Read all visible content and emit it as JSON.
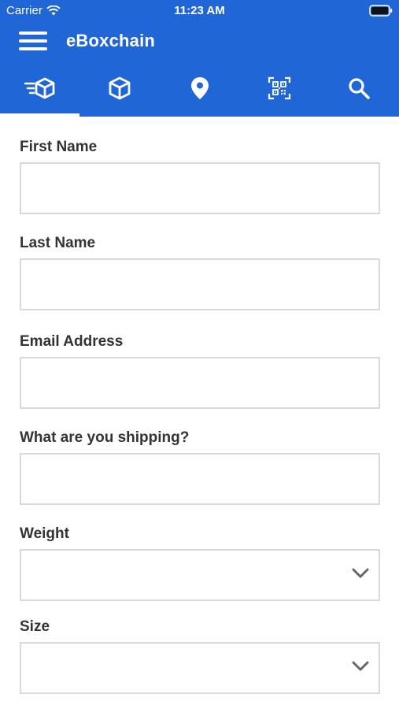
{
  "status_bar": {
    "carrier": "Carrier",
    "time": "11:23 AM"
  },
  "app_bar": {
    "title": "eBoxchain"
  },
  "tabs": [
    {
      "name": "shipping",
      "icon": "fast-box-icon",
      "active": true
    },
    {
      "name": "packages",
      "icon": "box-icon",
      "active": false
    },
    {
      "name": "location",
      "icon": "map-pin-icon",
      "active": false
    },
    {
      "name": "scan",
      "icon": "qr-scan-icon",
      "active": false
    },
    {
      "name": "search",
      "icon": "search-icon",
      "active": false
    }
  ],
  "form": {
    "first_name": {
      "label": "First Name",
      "value": "",
      "placeholder": ""
    },
    "last_name": {
      "label": "Last Name",
      "value": "",
      "placeholder": ""
    },
    "email": {
      "label": "Email Address",
      "value": "",
      "placeholder": ""
    },
    "shipping_item": {
      "label": "What are you shipping?",
      "value": "",
      "placeholder": ""
    },
    "weight": {
      "label": "Weight",
      "selected": ""
    },
    "size": {
      "label": "Size",
      "selected": ""
    }
  },
  "colors": {
    "brand": "#2166d6",
    "border": "#d9d9d9"
  }
}
